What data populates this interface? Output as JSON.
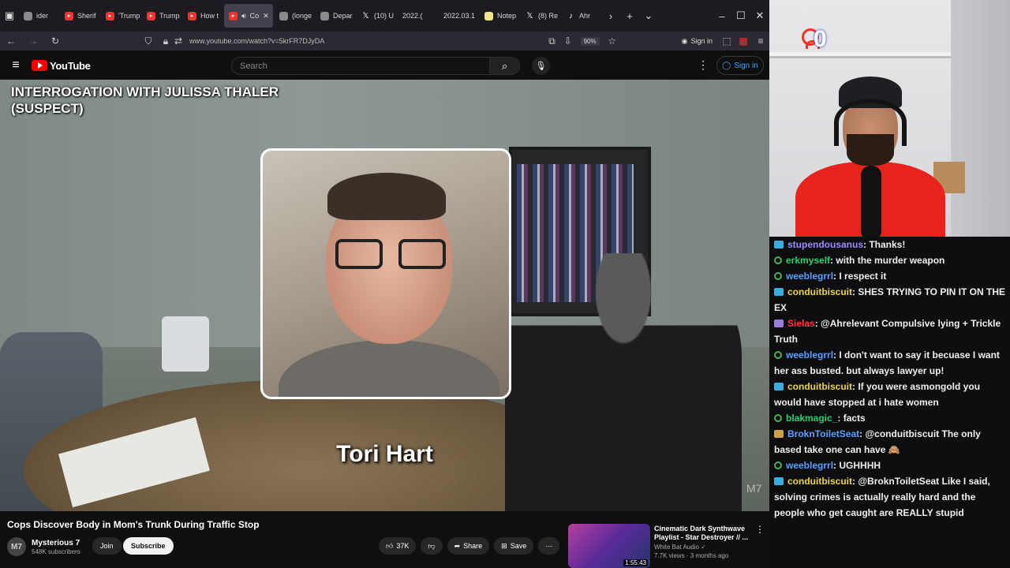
{
  "browser": {
    "tabs": [
      {
        "label": "ider",
        "icon": "tab-back-icon",
        "fav": "gen"
      },
      {
        "label": "Sherif",
        "icon": "youtube-icon",
        "fav": "yt"
      },
      {
        "label": "'Trump",
        "icon": "youtube-icon",
        "fav": "yt"
      },
      {
        "label": "Trump",
        "icon": "youtube-icon",
        "fav": "yt"
      },
      {
        "label": "How t",
        "icon": "youtube-icon",
        "fav": "yt"
      },
      {
        "label": "Co",
        "icon": "youtube-icon",
        "fav": "yt",
        "active": true
      },
      {
        "label": "(longe",
        "icon": "reddit-icon",
        "fav": "gen"
      },
      {
        "label": "Depar",
        "icon": "site-icon",
        "fav": "gen"
      },
      {
        "label": "(10) U",
        "icon": "x-icon",
        "fav": "x"
      },
      {
        "label": "2022.(",
        "icon": "doc-icon",
        "fav": "none"
      },
      {
        "label": "2022.03.1",
        "icon": "doc-icon",
        "fav": "none"
      },
      {
        "label": "Notep",
        "icon": "notepad-icon",
        "fav": "doc"
      },
      {
        "label": "(8) Re",
        "icon": "x-icon",
        "fav": "x"
      },
      {
        "label": "Ahr",
        "icon": "tiktok-icon",
        "fav": "tt"
      }
    ],
    "url": "www.youtube.com/watch?v=5krFR7DJyDA",
    "zoom": "90%",
    "signin": "Sign in"
  },
  "youtube": {
    "logo": "YouTube",
    "search_placeholder": "Search",
    "signin": "Sign in",
    "video": {
      "overlay_title": "INTERROGATION WITH JULISSA THALER\n(SUSPECT)",
      "lower_name": "Tori Hart",
      "watermark": "M7"
    },
    "title": "Cops Discover Body in Mom's Trunk During Traffic Stop",
    "channel": {
      "avatar": "M7",
      "name": "Mysterious 7",
      "subs": "548K subscribers",
      "join": "Join",
      "subscribe": "Subscribe"
    },
    "actions": {
      "likes": "37K",
      "share": "Share",
      "save": "Save"
    },
    "recommended": {
      "title": "Cinematic Dark Synthwave Playlist - Star Destroyer // ...",
      "channel": "White Bat Audio",
      "meta": "7.7K views · 3 months ago",
      "duration": "1:55:43"
    }
  },
  "stream": {
    "counter": "0"
  },
  "chat": [
    {
      "badge": "prime",
      "user": "stupendousanus",
      "color": "#9b8cff",
      "text": ": Thanks!"
    },
    {
      "badge": "pers",
      "user": "erkmyself",
      "color": "#2ecc71",
      "text": ": with the murder weapon"
    },
    {
      "badge": "pers",
      "user": "weeblegrrl",
      "color": "#5aa0ff",
      "text": ": I respect it"
    },
    {
      "badge": "prime",
      "user": "conduitbiscuit",
      "color": "#e8d44d",
      "text": ": SHES TRYING TO PIN IT ON THE EX"
    },
    {
      "badge": "sword",
      "user": "Sielas",
      "color": "#ff3b3b",
      "text": ": @Ahrelevant Compulsive lying + Trickle Truth"
    },
    {
      "badge": "pers",
      "user": "weeblegrrl",
      "color": "#5aa0ff",
      "text": ": I don't want to say it becuase I want her ass busted. but always lawyer up!"
    },
    {
      "badge": "prime",
      "user": "conduitbiscuit",
      "color": "#e8d44d",
      "text": ": If you were asmongold you would have stopped at i hate women"
    },
    {
      "badge": "pers",
      "user": "blakmagic_",
      "color": "#2ecc71",
      "text": ": facts"
    },
    {
      "badge": "cup",
      "user": "BroknToiletSeat",
      "color": "#5aa0ff",
      "text": ": @conduitbiscuit The only based take one can have 🙈"
    },
    {
      "badge": "pers",
      "user": "weeblegrrl",
      "color": "#5aa0ff",
      "text": ": UGHHHH"
    },
    {
      "badge": "prime",
      "user": "conduitbiscuit",
      "color": "#e8d44d",
      "text": ": @BroknToiletSeat Like I said, solving crimes is actually really hard and the people who get caught are REALLY stupid"
    }
  ]
}
